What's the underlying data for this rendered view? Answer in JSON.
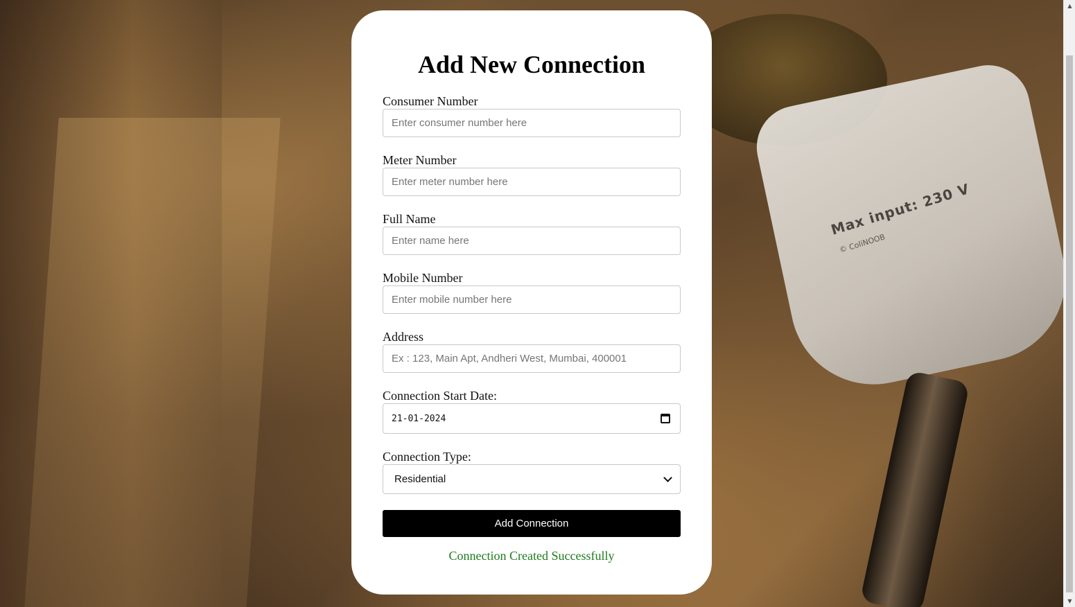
{
  "form": {
    "title": "Add New Connection",
    "consumer_number": {
      "label": "Consumer Number",
      "placeholder": "Enter consumer number here",
      "value": ""
    },
    "meter_number": {
      "label": "Meter Number",
      "placeholder": "Enter meter number here",
      "value": ""
    },
    "full_name": {
      "label": "Full Name",
      "placeholder": "Enter name here",
      "value": ""
    },
    "mobile_number": {
      "label": "Mobile Number",
      "placeholder": "Enter mobile number here",
      "value": ""
    },
    "address": {
      "label": "Address",
      "placeholder": "Ex : 123, Main Apt, Andheri West, Mumbai, 400001",
      "value": ""
    },
    "start_date": {
      "label": "Connection Start Date:",
      "value": "21-01-2024"
    },
    "connection_type": {
      "label": "Connection Type:",
      "selected": "Residential"
    },
    "submit_label": "Add Connection",
    "success_message": "Connection Created Successfully"
  },
  "background": {
    "device_text": "Max input: 230 V",
    "device_subtext": "© ColiNOOB"
  },
  "icons": {
    "date_picker": "calendar-icon",
    "select": "chevron-down-icon"
  },
  "colors": {
    "card_background": "#ffffff",
    "button_background": "#000000",
    "button_text": "#ffffff",
    "success_text": "#1e7a1e"
  }
}
